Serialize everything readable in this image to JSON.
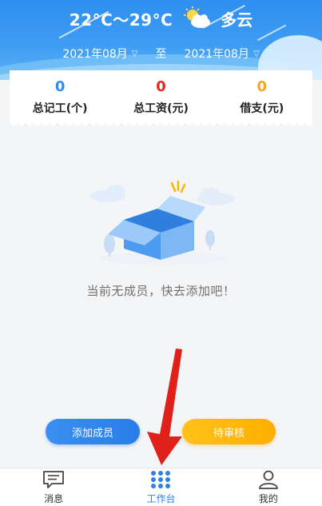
{
  "weather": {
    "temperature": "22°C～29°C",
    "description": "多云",
    "icon": "partly-cloudy-icon"
  },
  "date_range": {
    "start": "2021年08月",
    "separator": "至",
    "end": "2021年08月"
  },
  "stats": [
    {
      "value": "0",
      "label": "总记工(个)",
      "color": "#2f8ff0"
    },
    {
      "value": "0",
      "label": "总工资(元)",
      "color": "#e8281e"
    },
    {
      "value": "0",
      "label": "借支(元)",
      "color": "#f5a623"
    }
  ],
  "empty_state": {
    "message": "当前无成员，快去添加吧！",
    "icon": "empty-box-icon"
  },
  "actions": {
    "add_member": "添加成员",
    "pending_review": "待审核"
  },
  "bottom_nav": {
    "items": [
      {
        "label": "消息",
        "icon": "message-icon",
        "active": false
      },
      {
        "label": "工作台",
        "icon": "grid-icon",
        "active": true
      },
      {
        "label": "我的",
        "icon": "user-icon",
        "active": false
      }
    ]
  },
  "colors": {
    "primary": "#2f8ff0",
    "accent_yellow": "#ffb400",
    "annotation_arrow": "#e0201a"
  }
}
